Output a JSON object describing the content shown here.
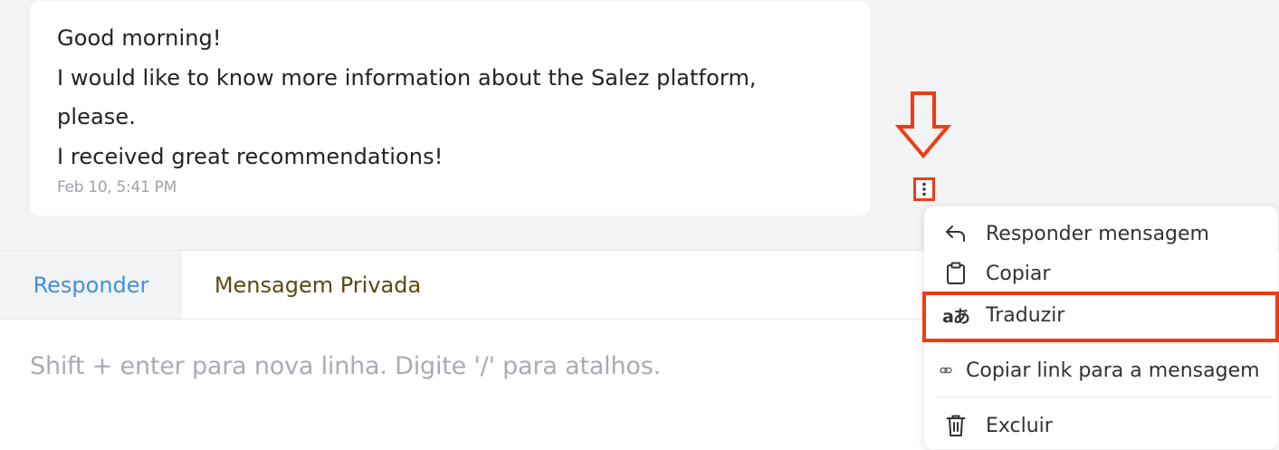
{
  "message": {
    "lines": [
      "Good morning!",
      "I would like to know more information about the Salez platform,",
      "please.",
      "I received great recommendations!"
    ],
    "timestamp": "Feb 10, 5:41 PM"
  },
  "composer": {
    "tabs": [
      {
        "label": "Responder",
        "active": true
      },
      {
        "label": "Mensagem Privada",
        "active": false
      }
    ],
    "placeholder": "Shift + enter para nova linha. Digite '/' para atalhos."
  },
  "context_menu": {
    "items": [
      {
        "label": "Responder mensagem",
        "icon": "reply-icon"
      },
      {
        "label": "Copiar",
        "icon": "clipboard-icon"
      },
      {
        "label": "Traduzir",
        "icon": "translate-icon",
        "highlighted": true
      },
      {
        "label": "Copiar link para a mensagem",
        "icon": "link-icon"
      },
      {
        "label": "Excluir",
        "icon": "trash-icon"
      }
    ]
  },
  "annotation": {
    "color": "#ee3d12",
    "arrow_icon": "down-arrow-icon"
  },
  "colors": {
    "accent_blue": "#3f8fe0",
    "private_tab_text": "#5a4a12",
    "background": "#f2f3f5"
  }
}
